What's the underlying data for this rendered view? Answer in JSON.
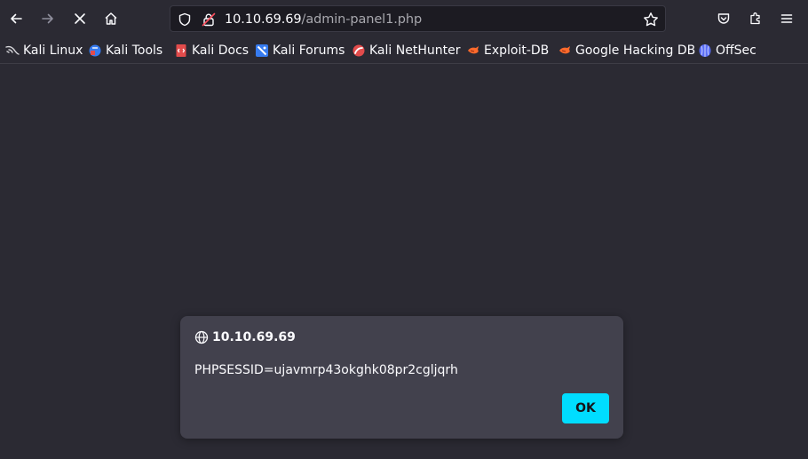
{
  "url": {
    "host": "10.10.69.69",
    "path": "/admin-panel1.php"
  },
  "bookmarks": [
    {
      "label": "Kali Linux",
      "icon": "kali-dragon-icon"
    },
    {
      "label": "Kali Tools",
      "icon": "kali-tools-icon"
    },
    {
      "label": "Kali Docs",
      "icon": "kali-docs-icon"
    },
    {
      "label": "Kali Forums",
      "icon": "kali-forums-icon"
    },
    {
      "label": "Kali NetHunter",
      "icon": "kali-nethunter-icon"
    },
    {
      "label": "Exploit-DB",
      "icon": "exploit-db-icon"
    },
    {
      "label": "Google Hacking DB",
      "icon": "exploit-db-icon"
    },
    {
      "label": "OffSec",
      "icon": "offsec-icon"
    }
  ],
  "dialog": {
    "origin": "10.10.69.69",
    "message": "PHPSESSID=ujavmrp43okghk08pr2cgljqrh",
    "ok_label": "OK"
  },
  "colors": {
    "accent": "#00ddff",
    "background": "#2b2a33",
    "dialog": "#42414d"
  }
}
